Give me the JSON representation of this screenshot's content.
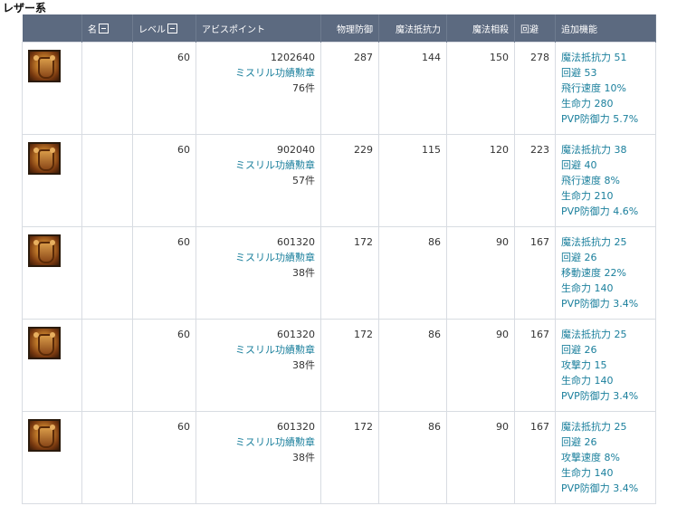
{
  "section_title": "レザー系",
  "headers": {
    "name": "名",
    "level": "レベル",
    "abyss_points": "アビスポイント",
    "phys_def": "物理防御",
    "magic_resist": "魔法抵抗力",
    "magic_cancel": "魔法相殺",
    "evasion": "回避",
    "extra": "追加機能"
  },
  "rows": [
    {
      "icon": "leather-chest-armor-icon",
      "name": "",
      "level": "60",
      "ap": "1202640",
      "medal": "ミスリル功績勲章",
      "medal_count": "76件",
      "phys_def": "287",
      "magic_resist": "144",
      "magic_cancel": "150",
      "evasion": "278",
      "extra": [
        "魔法抵抗力 51",
        "回避 53",
        "飛行速度 10%",
        "生命力 280",
        "PVP防御力 5.7%"
      ]
    },
    {
      "icon": "leather-leg-armor-icon",
      "name": "",
      "level": "60",
      "ap": "902040",
      "medal": "ミスリル功績勲章",
      "medal_count": "57件",
      "phys_def": "229",
      "magic_resist": "115",
      "magic_cancel": "120",
      "evasion": "223",
      "extra": [
        "魔法抵抗力 38",
        "回避 40",
        "飛行速度 8%",
        "生命力 210",
        "PVP防御力 4.6%"
      ]
    },
    {
      "icon": "leather-boots-icon",
      "name": "",
      "level": "60",
      "ap": "601320",
      "medal": "ミスリル功績勲章",
      "medal_count": "38件",
      "phys_def": "172",
      "magic_resist": "86",
      "magic_cancel": "90",
      "evasion": "167",
      "extra": [
        "魔法抵抗力 25",
        "回避 26",
        "移動速度 22%",
        "生命力 140",
        "PVP防御力 3.4%"
      ]
    },
    {
      "icon": "leather-gloves-icon",
      "name": "",
      "level": "60",
      "ap": "601320",
      "medal": "ミスリル功績勲章",
      "medal_count": "38件",
      "phys_def": "172",
      "magic_resist": "86",
      "magic_cancel": "90",
      "evasion": "167",
      "extra": [
        "魔法抵抗力 25",
        "回避 26",
        "攻撃力 15",
        "生命力 140",
        "PVP防御力 3.4%"
      ]
    },
    {
      "icon": "leather-shoulders-icon",
      "name": "",
      "level": "60",
      "ap": "601320",
      "medal": "ミスリル功績勲章",
      "medal_count": "38件",
      "phys_def": "172",
      "magic_resist": "86",
      "magic_cancel": "90",
      "evasion": "167",
      "extra": [
        "魔法抵抗力 25",
        "回避 26",
        "攻撃速度 8%",
        "生命力 140",
        "PVP防御力 3.4%"
      ]
    }
  ]
}
